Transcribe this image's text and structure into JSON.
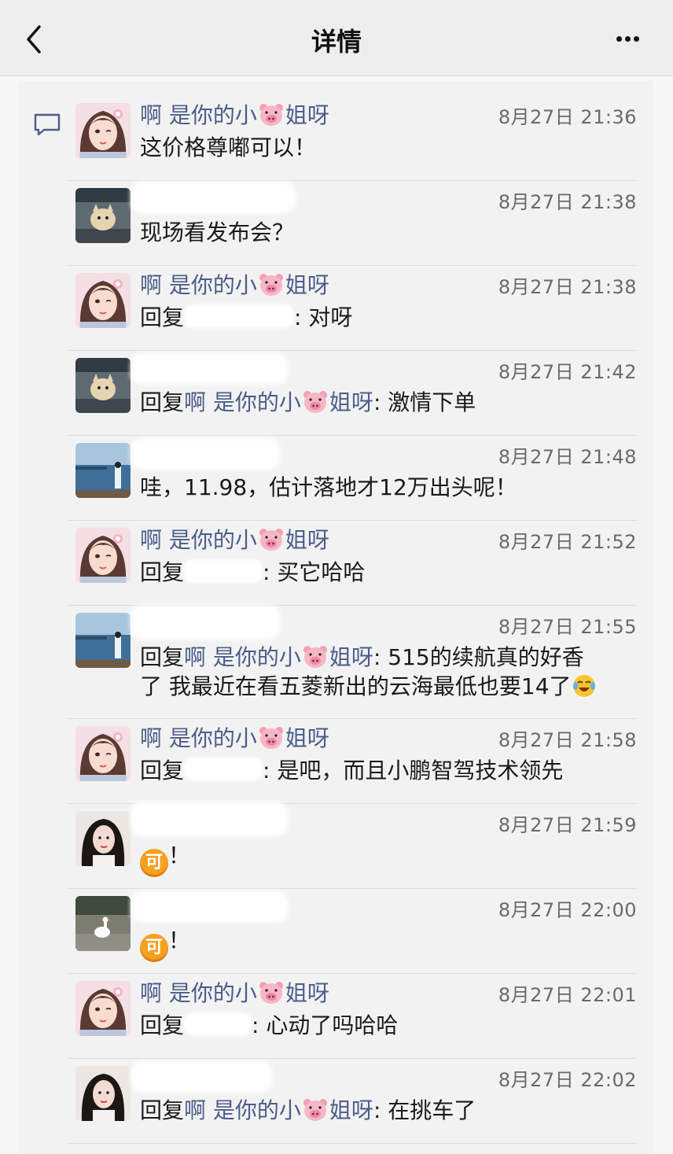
{
  "nav": {
    "title": "详情"
  },
  "user_me": {
    "name_a": "啊 是你的小",
    "name_b": "姐呀"
  },
  "comments": [
    {
      "time": "8月27日 21:36",
      "text": "这价格尊嘟可以！"
    },
    {
      "time": "8月27日 21:38",
      "text": "现场看发布会？"
    },
    {
      "time": "8月27日 21:38",
      "prefix": "回复",
      "text": ": 对呀"
    },
    {
      "time": "8月27日 21:42",
      "prefix": "回复",
      "text": ": 激情下单"
    },
    {
      "time": "8月27日 21:48",
      "text": "哇，11.98，估计落地才12万出头呢！"
    },
    {
      "time": "8月27日 21:52",
      "prefix": "回复",
      "text": ": 买它哈哈"
    },
    {
      "time": "8月27日 21:55",
      "prefix": "回复",
      "text": ": 515的续航真的好香",
      "text2": "了 我最近在看五菱新出的云海最低也要14了"
    },
    {
      "time": "8月27日 21:58",
      "prefix": "回复",
      "text": ": 是吧，而且小鹏智驾技术领先"
    },
    {
      "time": "8月27日 21:59",
      "emoji": "可",
      "text": "！"
    },
    {
      "time": "8月27日 22:00",
      "emoji": "可",
      "text": "！"
    },
    {
      "time": "8月27日 22:01",
      "prefix": "回复",
      "text": ": 心动了吗哈哈"
    },
    {
      "time": "8月27日 22:02",
      "prefix": "回复",
      "text": ": 在挑车了"
    }
  ]
}
